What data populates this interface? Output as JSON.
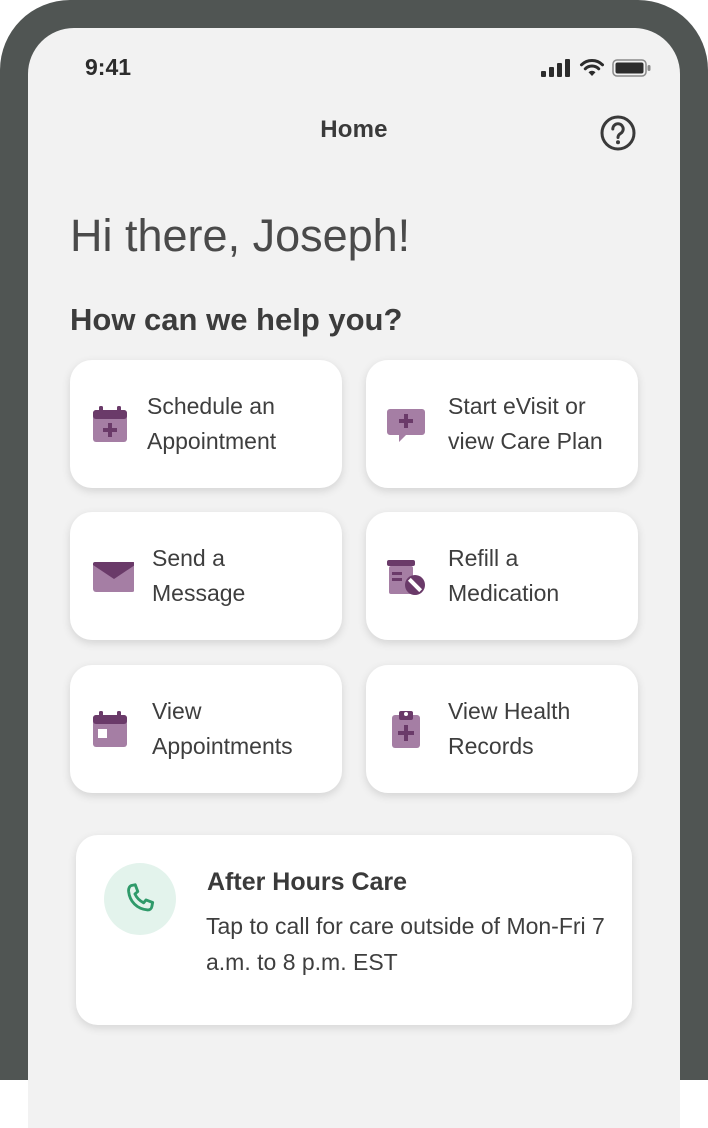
{
  "status_bar": {
    "time": "9:41",
    "icons": [
      "cellular-signal-icon",
      "wifi-icon",
      "battery-icon"
    ]
  },
  "header": {
    "title": "Home",
    "help_icon": "question-circle-icon"
  },
  "greeting": "Hi there, Joseph!",
  "subheading": "How can we help you?",
  "actions": [
    {
      "line1": "Schedule an",
      "line2": "Appointment",
      "icon": "calendar-plus-icon"
    },
    {
      "line1": "Start eVisit or",
      "line2": "view Care Plan",
      "icon": "chat-plus-icon"
    },
    {
      "line1": "Send a",
      "line2": "Message",
      "icon": "envelope-icon"
    },
    {
      "line1": "Refill a",
      "line2": "Medication",
      "icon": "pill-bottle-icon"
    },
    {
      "line1": "View",
      "line2": "Appointments",
      "icon": "calendar-icon"
    },
    {
      "line1": "View Health",
      "line2": "Records",
      "icon": "clipboard-plus-icon"
    }
  ],
  "after_hours": {
    "title": "After Hours Care",
    "text": "Tap to call for care outside of Mon-Fri 7 a.m. to 8 p.m. EST",
    "icon": "phone-icon"
  },
  "colors": {
    "accent": "#7d4a7c",
    "accent_light": "#a57ea4",
    "phone_green": "#2f9a6a",
    "phone_bg": "#e3f3ec",
    "frame": "#505553",
    "screen_bg": "#f2f2f2"
  }
}
